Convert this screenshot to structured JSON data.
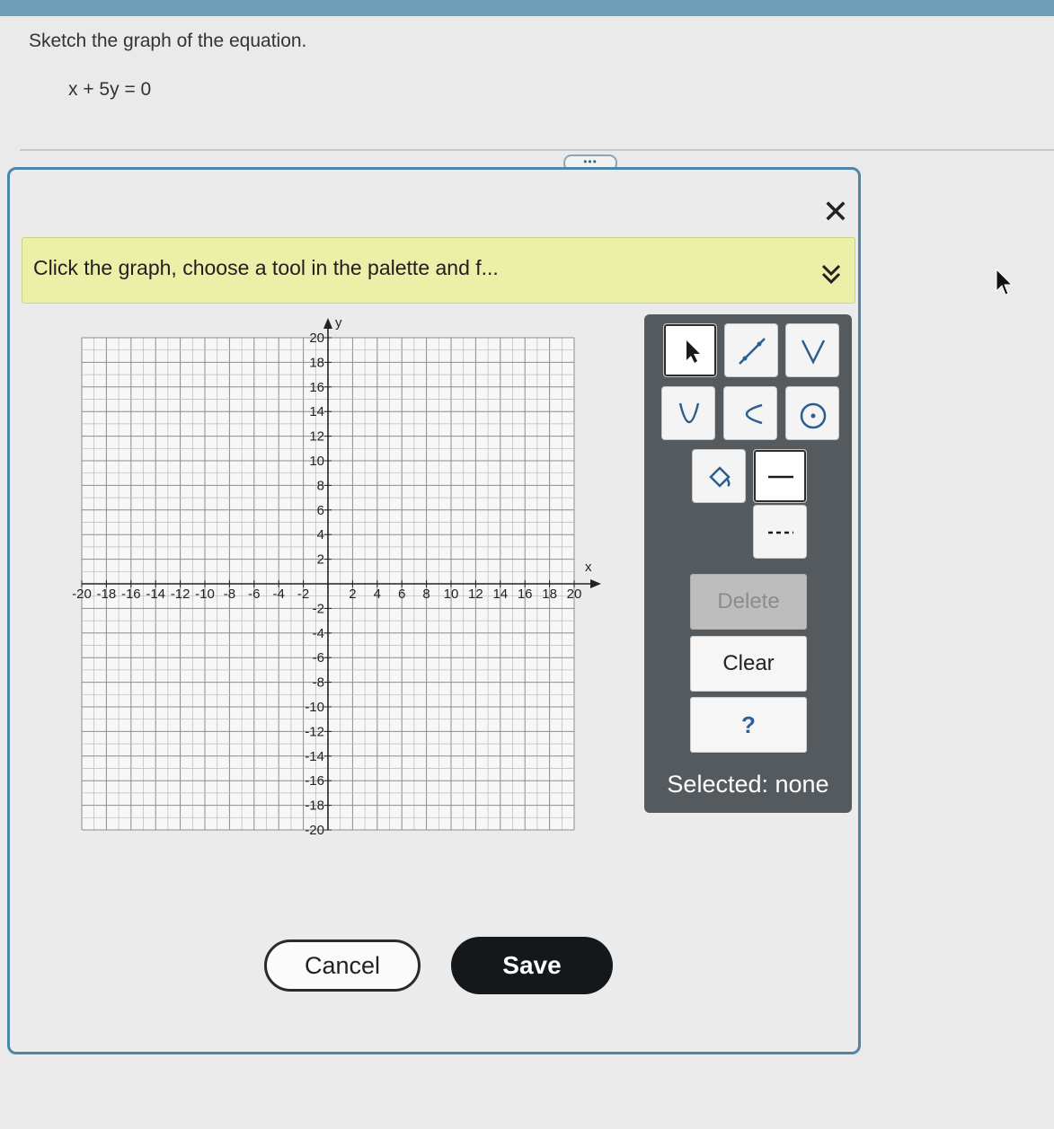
{
  "prompt": {
    "question": "Sketch the graph of the equation.",
    "equation": "x + 5y = 0"
  },
  "more_button": "•••",
  "dialog": {
    "close_symbol": "✕",
    "instruction": "Click the graph, choose a tool in the palette and f..."
  },
  "graph": {
    "x_axis_label": "x",
    "y_axis_label": "y",
    "x_min": -20,
    "x_max": 20,
    "y_min": -20,
    "y_max": 20,
    "tick_step": 2,
    "grid": true,
    "x_tick_labels": [
      "-20",
      "-18",
      "-16",
      "-14",
      "-12",
      "-10",
      "-8",
      "-6",
      "-4",
      "-2",
      "2",
      "4",
      "6",
      "8",
      "10",
      "12",
      "14",
      "16",
      "18",
      "20"
    ],
    "y_tick_labels": [
      "20",
      "18",
      "16",
      "14",
      "12",
      "10",
      "8",
      "6",
      "4",
      "2",
      "-2",
      "-4",
      "-6",
      "-8",
      "-10",
      "-12",
      "-14",
      "-16",
      "-18",
      "-20"
    ]
  },
  "palette": {
    "tools": [
      {
        "name": "pointer-tool",
        "icon": "arrow-pointer-icon"
      },
      {
        "name": "line-tool",
        "icon": "line-segment-icon"
      },
      {
        "name": "absolute-value-tool",
        "icon": "v-shape-icon"
      },
      {
        "name": "parabola-tool",
        "icon": "parabola-icon"
      },
      {
        "name": "sideways-parabola-tool",
        "icon": "sideways-parabola-icon"
      },
      {
        "name": "circle-tool",
        "icon": "circle-icon"
      },
      {
        "name": "fill-tool",
        "icon": "paint-bucket-icon"
      },
      {
        "name": "solid-line-tool",
        "icon": "solid-line-icon"
      },
      {
        "name": "dashed-line-tool",
        "icon": "dashed-line-icon"
      }
    ],
    "delete_label": "Delete",
    "clear_label": "Clear",
    "help_label": "?",
    "selected_text": "Selected: none"
  },
  "footer": {
    "cancel_label": "Cancel",
    "save_label": "Save"
  },
  "colors": {
    "instruction_bg": "#ecefa8",
    "palette_bg": "#555a5e",
    "dialog_border": "#4d86ab",
    "save_bg": "#15181b"
  }
}
